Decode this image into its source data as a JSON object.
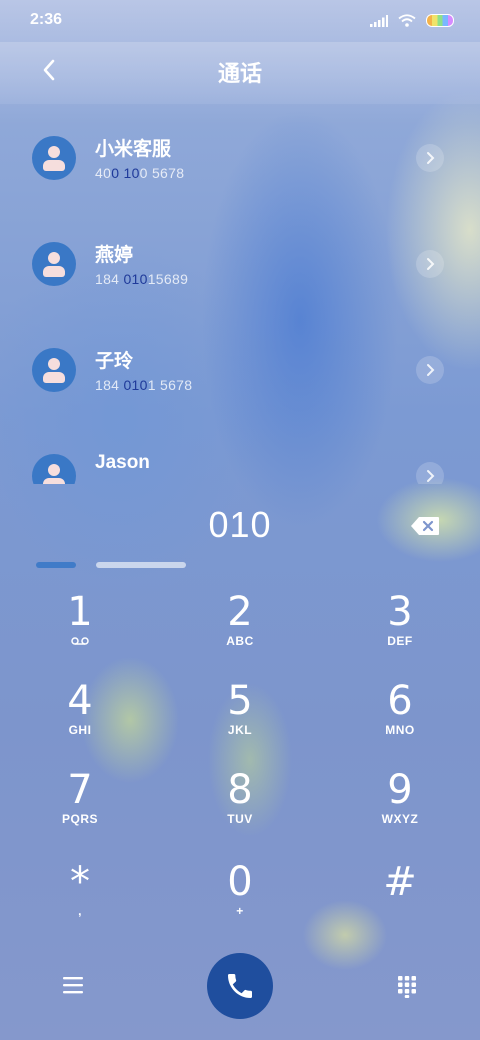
{
  "status": {
    "time": "2:36"
  },
  "header": {
    "title": "通话"
  },
  "contacts": [
    {
      "name": "小米客服",
      "number_pre": "40",
      "number_hl1": "0",
      "number_mid": " ",
      "number_hl2": "10",
      "number_post": "0 5678"
    },
    {
      "name": "燕婷",
      "number_pre": "184 ",
      "number_hl1": "010",
      "number_mid": "",
      "number_hl2": "",
      "number_post": "15689"
    },
    {
      "name": "子玲",
      "number_pre": "184 ",
      "number_hl1": "010",
      "number_mid": "",
      "number_hl2": "",
      "number_post": "1 5678"
    },
    {
      "name": "Jason",
      "number_pre": "",
      "number_hl1": "",
      "number_mid": "",
      "number_hl2": "",
      "number_post": ""
    }
  ],
  "dialer": {
    "digits": "010"
  },
  "keys": [
    {
      "num": "1",
      "sub": ""
    },
    {
      "num": "2",
      "sub": "ABC"
    },
    {
      "num": "3",
      "sub": "DEF"
    },
    {
      "num": "4",
      "sub": "GHI"
    },
    {
      "num": "5",
      "sub": "JKL"
    },
    {
      "num": "6",
      "sub": "MNO"
    },
    {
      "num": "7",
      "sub": "PQRS"
    },
    {
      "num": "8",
      "sub": "TUV"
    },
    {
      "num": "9",
      "sub": "WXYZ"
    },
    {
      "num": "*",
      "sub": ","
    },
    {
      "num": "0",
      "sub": "+"
    },
    {
      "num": "#",
      "sub": ""
    }
  ],
  "colors": {
    "accent": "#1f4e9e",
    "avatar": "#3a78c6",
    "highlight": "#1f3a9a"
  },
  "icons": {
    "back": "chevron-left-icon",
    "delete": "backspace-icon",
    "menu": "menu-icon",
    "call": "phone-icon",
    "keypad": "keypad-grid-icon"
  }
}
